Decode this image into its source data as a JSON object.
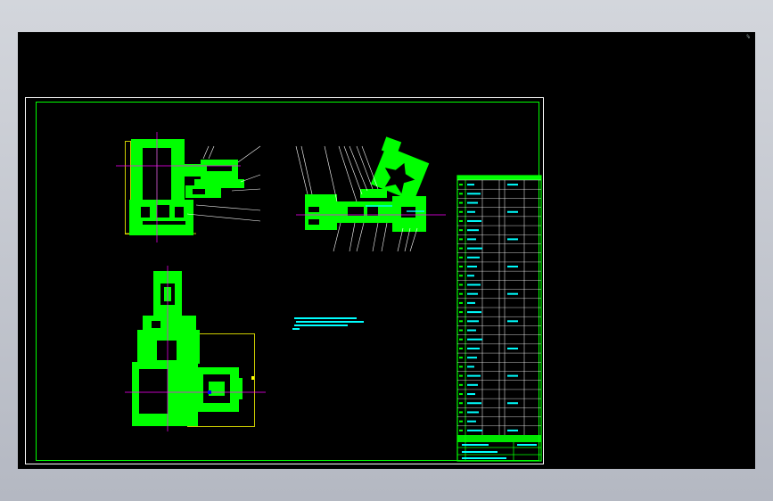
{
  "canvas": {
    "background": "#000000",
    "corner_mark": "%"
  },
  "colors": {
    "part_fill": "#00ff00",
    "sheet_border": "#ffffff",
    "inner_frame": "#00ff00",
    "centerline": "#ff00ff",
    "outline": "#ffff00",
    "leader": "#ffffff",
    "table_text": "#00ffff"
  },
  "views": {
    "front": "front-view",
    "side": "side-view",
    "top": "top-view"
  },
  "title_block": {
    "rows": 28
  }
}
